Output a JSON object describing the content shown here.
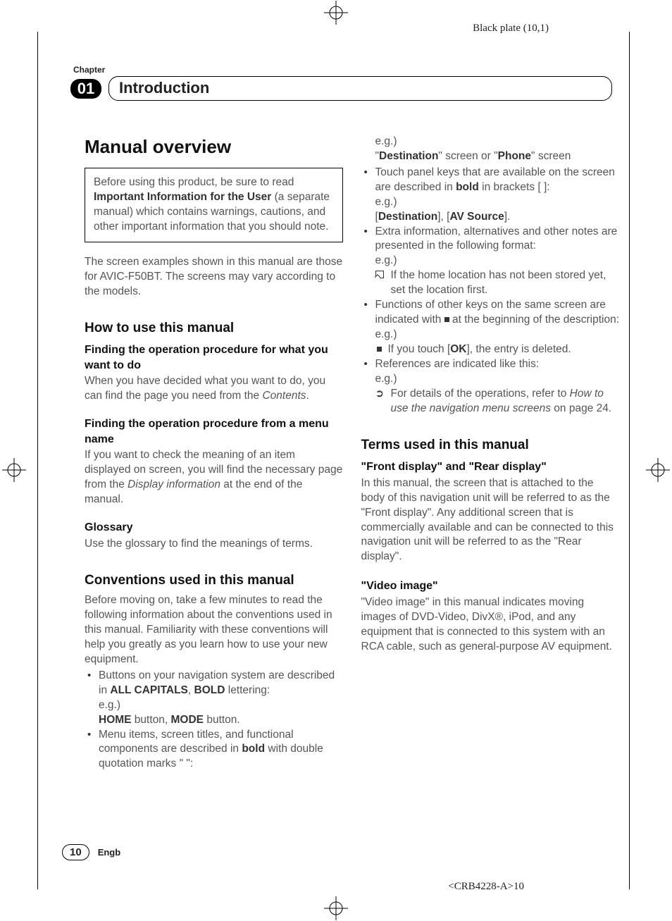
{
  "meta": {
    "black_plate": "Black plate (10,1)",
    "doc_code": "<CRB4228-A>10"
  },
  "chapter": {
    "label": "Chapter",
    "number": "01",
    "title": "Introduction"
  },
  "left": {
    "h1": "Manual overview",
    "callout_pre": "Before using this product, be sure to read ",
    "callout_bold": "Important Information for the User",
    "callout_post": " (a separate manual) which contains warnings, cautions, and other important information that you should note.",
    "intro": "The screen examples shown in this manual are those for AVIC-F50BT. The screens may vary according to the models.",
    "h2a": "How to use this manual",
    "h3a": "Finding the operation procedure for what you want to do",
    "pa": "When you have decided what you want to do, you can find the page you need from the ",
    "pa_em": "Contents",
    "h3b": "Finding the operation procedure from a menu name",
    "pb": "If you want to check the meaning of an item displayed on screen, you will find the necessary page from the ",
    "pb_em": "Display information",
    "pb2": " at the end of the manual.",
    "h3c": "Glossary",
    "pc": "Use the glossary to find the meanings of terms.",
    "h2b": "Conventions used in this manual",
    "pconv": "Before moving on, take a few minutes to read the following information about the conventions used in this manual. Familiarity with these conventions will help you greatly as you learn how to use your new equipment.",
    "b1_pre": "Buttons on your navigation system are described in ",
    "b1_bold1": "ALL CAPITALS",
    "b1_mid": ", ",
    "b1_bold2": "BOLD",
    "b1_post": " lettering:",
    "eg": "e.g.)",
    "b1_ex_b1": "HOME",
    "b1_ex_mid": " button, ",
    "b1_ex_b2": "MODE",
    "b1_ex_post": " button.",
    "b2_pre": "Menu items, screen titles, and functional components are described in ",
    "b2_bold": "bold",
    "b2_post": " with double quotation marks \" \":"
  },
  "right": {
    "eg": "e.g.)",
    "r1_pre": "\"",
    "r1_b1": "Destination",
    "r1_mid": "\" screen or \"",
    "r1_b2": "Phone",
    "r1_post": "\" screen",
    "b3_pre": "Touch panel keys that are available on the screen are described in ",
    "b3_bold": "bold",
    "b3_post": " in brackets [ ]:",
    "b3_ex_b1": "Destination",
    "b3_ex_b2": "AV Source",
    "b4": "Extra information, alternatives and other notes are presented in the following format:",
    "b4_note": "If the home location has not been stored yet, set the location first.",
    "b5_pre": "Functions of other keys on the same screen are indicated with ",
    "b5_post": " at the beginning of the description:",
    "b5_ex_pre": "If you touch [",
    "b5_ex_b": "OK",
    "b5_ex_post": "], the entry is deleted.",
    "b6": "References are indicated like this:",
    "b6_ref_pre": "For details of the operations, refer to ",
    "b6_ref_em": "How to use the navigation menu screens",
    "b6_ref_post": " on page 24.",
    "h2": "Terms used in this manual",
    "h3a": "\"Front display\" and \"Rear display\"",
    "pa": "In this manual, the screen that is attached to the body of this navigation unit will be referred to as the \"Front display\". Any additional screen that is commercially available and can be connected to this navigation unit will be referred to as the \"Rear display\".",
    "h3b": "\"Video image\"",
    "pb": "\"Video image\" in this manual indicates moving images of DVD-Video, DivX®, iPod, and any equipment that is connected to this system with an RCA cable, such as general-purpose AV equipment."
  },
  "footer": {
    "page": "10",
    "lang": "Engb"
  }
}
